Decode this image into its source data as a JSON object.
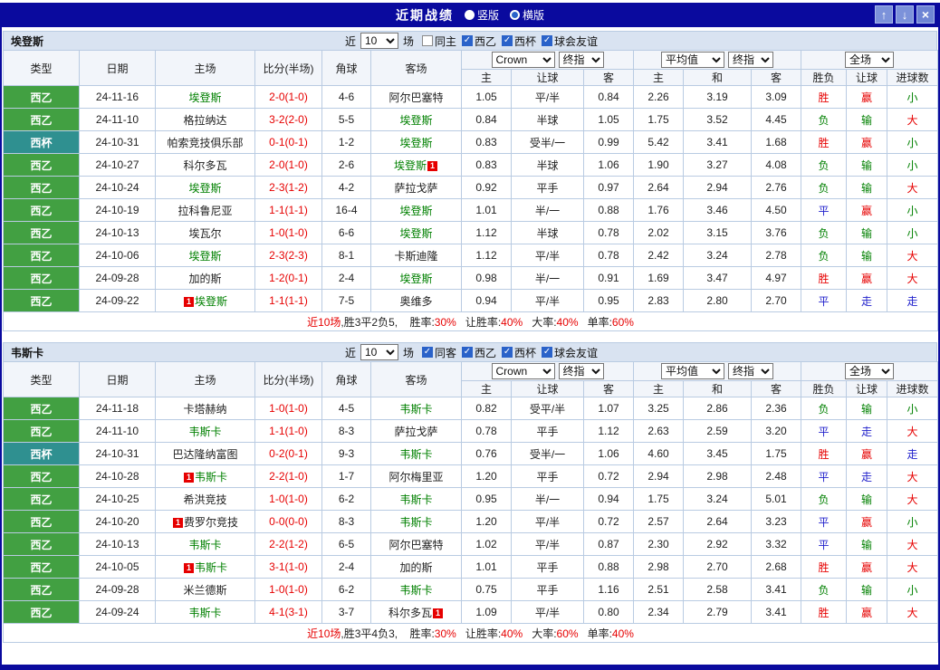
{
  "titlebar": {
    "title": "近期战绩",
    "layout_options": [
      {
        "label": "竖版",
        "selected": false
      },
      {
        "label": "横版",
        "selected": true
      }
    ],
    "up_icon": "↑",
    "down_icon": "↓",
    "close_icon": "×"
  },
  "theme": {
    "league_colors": {
      "西乙": "#42a042",
      "西杯": "#2f9090"
    },
    "result_colors": {
      "胜": "#e60000",
      "平": "#2222cc",
      "负": "#008000",
      "赢": "#e60000",
      "走": "#2222cc",
      "输": "#008000",
      "大": "#e60000",
      "小": "#008000"
    },
    "focus_team_color": "#008000",
    "score_color": "#e60000",
    "summary_red": "#e60000"
  },
  "filter": {
    "near_label": "近",
    "games_label": "场",
    "league_filters": [
      {
        "label": "西乙",
        "checked": true
      },
      {
        "label": "西杯",
        "checked": true
      },
      {
        "label": "球会友谊",
        "checked": true
      }
    ]
  },
  "columns": {
    "type": "类型",
    "date": "日期",
    "home": "主场",
    "score": "比分(半场)",
    "corner": "角球",
    "away": "客场",
    "asian_dropdowns": [
      "Crown",
      "终指"
    ],
    "asian_home": "主",
    "asian_handicap": "让球",
    "asian_away": "客",
    "euro_dropdowns": [
      "平均值",
      "终指"
    ],
    "euro_home": "主",
    "euro_draw": "和",
    "euro_away": "客",
    "result": "胜负",
    "handicap_result": "让球",
    "goals": "进球数",
    "scope_dropdown": "全场"
  },
  "sections": [
    {
      "team": "埃登斯",
      "near_value": "10",
      "same_label": "同主",
      "same_checked": false,
      "rows": [
        {
          "league": "西乙",
          "date": "24-11-16",
          "home": "埃登斯",
          "home_focus": true,
          "away": "阿尔巴塞特",
          "away_focus": false,
          "score": "2-0(1-0)",
          "corner": "4-6",
          "asian_home": "1.05",
          "handicap": "平/半",
          "asian_away": "0.84",
          "euro_home": "2.26",
          "euro_draw": "3.19",
          "euro_away": "3.09",
          "result": "胜",
          "handicap_result": "赢",
          "goals": "小"
        },
        {
          "league": "西乙",
          "date": "24-11-10",
          "home": "格拉纳达",
          "home_focus": false,
          "away": "埃登斯",
          "away_focus": true,
          "score": "3-2(2-0)",
          "corner": "5-5",
          "asian_home": "0.84",
          "handicap": "半球",
          "asian_away": "1.05",
          "euro_home": "1.75",
          "euro_draw": "3.52",
          "euro_away": "4.45",
          "result": "负",
          "handicap_result": "输",
          "goals": "大"
        },
        {
          "league": "西杯",
          "date": "24-10-31",
          "home": "帕索竞技俱乐部",
          "home_focus": false,
          "away": "埃登斯",
          "away_focus": true,
          "score": "0-1(0-1)",
          "corner": "1-2",
          "asian_home": "0.83",
          "handicap": "受半/一",
          "asian_away": "0.99",
          "euro_home": "5.42",
          "euro_draw": "3.41",
          "euro_away": "1.68",
          "result": "胜",
          "handicap_result": "赢",
          "goals": "小"
        },
        {
          "league": "西乙",
          "date": "24-10-27",
          "home": "科尔多瓦",
          "home_focus": false,
          "away": "埃登斯",
          "away_focus": true,
          "away_card_after": "1",
          "score": "2-0(1-0)",
          "corner": "2-6",
          "asian_home": "0.83",
          "handicap": "半球",
          "asian_away": "1.06",
          "euro_home": "1.90",
          "euro_draw": "3.27",
          "euro_away": "4.08",
          "result": "负",
          "handicap_result": "输",
          "goals": "小"
        },
        {
          "league": "西乙",
          "date": "24-10-24",
          "home": "埃登斯",
          "home_focus": true,
          "away": "萨拉戈萨",
          "away_focus": false,
          "score": "2-3(1-2)",
          "corner": "4-2",
          "asian_home": "0.92",
          "handicap": "平手",
          "asian_away": "0.97",
          "euro_home": "2.64",
          "euro_draw": "2.94",
          "euro_away": "2.76",
          "result": "负",
          "handicap_result": "输",
          "goals": "大"
        },
        {
          "league": "西乙",
          "date": "24-10-19",
          "home": "拉科鲁尼亚",
          "home_focus": false,
          "away": "埃登斯",
          "away_focus": true,
          "score": "1-1(1-1)",
          "corner": "16-4",
          "asian_home": "1.01",
          "handicap": "半/一",
          "asian_away": "0.88",
          "euro_home": "1.76",
          "euro_draw": "3.46",
          "euro_away": "4.50",
          "result": "平",
          "handicap_result": "赢",
          "goals": "小"
        },
        {
          "league": "西乙",
          "date": "24-10-13",
          "home": "埃瓦尔",
          "home_focus": false,
          "away": "埃登斯",
          "away_focus": true,
          "score": "1-0(1-0)",
          "corner": "6-6",
          "asian_home": "1.12",
          "handicap": "半球",
          "asian_away": "0.78",
          "euro_home": "2.02",
          "euro_draw": "3.15",
          "euro_away": "3.76",
          "result": "负",
          "handicap_result": "输",
          "goals": "小"
        },
        {
          "league": "西乙",
          "date": "24-10-06",
          "home": "埃登斯",
          "home_focus": true,
          "away": "卡斯迪隆",
          "away_focus": false,
          "score": "2-3(2-3)",
          "corner": "8-1",
          "asian_home": "1.12",
          "handicap": "平/半",
          "asian_away": "0.78",
          "euro_home": "2.42",
          "euro_draw": "3.24",
          "euro_away": "2.78",
          "result": "负",
          "handicap_result": "输",
          "goals": "大"
        },
        {
          "league": "西乙",
          "date": "24-09-28",
          "home": "加的斯",
          "home_focus": false,
          "away": "埃登斯",
          "away_focus": true,
          "score": "1-2(0-1)",
          "corner": "2-4",
          "asian_home": "0.98",
          "handicap": "半/一",
          "asian_away": "0.91",
          "euro_home": "1.69",
          "euro_draw": "3.47",
          "euro_away": "4.97",
          "result": "胜",
          "handicap_result": "赢",
          "goals": "大"
        },
        {
          "league": "西乙",
          "date": "24-09-22",
          "home": "埃登斯",
          "home_focus": true,
          "home_card_before": "1",
          "away": "奥维多",
          "away_focus": false,
          "score": "1-1(1-1)",
          "corner": "7-5",
          "asian_home": "0.94",
          "handicap": "平/半",
          "asian_away": "0.95",
          "euro_home": "2.83",
          "euro_draw": "2.80",
          "euro_away": "2.70",
          "result": "平",
          "handicap_result": "走",
          "goals": "走"
        }
      ],
      "summary": {
        "games": "近10场",
        "record": ",胜3平2负5,",
        "stats": [
          {
            "label": "胜率:",
            "value": "30%"
          },
          {
            "label": "让胜率:",
            "value": "40%"
          },
          {
            "label": "大率:",
            "value": "40%"
          },
          {
            "label": "单率:",
            "value": "60%"
          }
        ]
      }
    },
    {
      "team": "韦斯卡",
      "near_value": "10",
      "same_label": "同客",
      "same_checked": true,
      "rows": [
        {
          "league": "西乙",
          "date": "24-11-18",
          "home": "卡塔赫纳",
          "home_focus": false,
          "away": "韦斯卡",
          "away_focus": true,
          "score": "1-0(1-0)",
          "corner": "4-5",
          "asian_home": "0.82",
          "handicap": "受平/半",
          "asian_away": "1.07",
          "euro_home": "3.25",
          "euro_draw": "2.86",
          "euro_away": "2.36",
          "result": "负",
          "handicap_result": "输",
          "goals": "小"
        },
        {
          "league": "西乙",
          "date": "24-11-10",
          "home": "韦斯卡",
          "home_focus": true,
          "away": "萨拉戈萨",
          "away_focus": false,
          "score": "1-1(1-0)",
          "corner": "8-3",
          "asian_home": "0.78",
          "handicap": "平手",
          "asian_away": "1.12",
          "euro_home": "2.63",
          "euro_draw": "2.59",
          "euro_away": "3.20",
          "result": "平",
          "handicap_result": "走",
          "goals": "大"
        },
        {
          "league": "西杯",
          "date": "24-10-31",
          "home": "巴达隆纳富图",
          "home_focus": false,
          "away": "韦斯卡",
          "away_focus": true,
          "score": "0-2(0-1)",
          "corner": "9-3",
          "asian_home": "0.76",
          "handicap": "受半/一",
          "asian_away": "1.06",
          "euro_home": "4.60",
          "euro_draw": "3.45",
          "euro_away": "1.75",
          "result": "胜",
          "handicap_result": "赢",
          "goals": "走"
        },
        {
          "league": "西乙",
          "date": "24-10-28",
          "home": "韦斯卡",
          "home_focus": true,
          "home_card_before": "1",
          "away": "阿尔梅里亚",
          "away_focus": false,
          "score": "2-2(1-0)",
          "corner": "1-7",
          "asian_home": "1.20",
          "handicap": "平手",
          "asian_away": "0.72",
          "euro_home": "2.94",
          "euro_draw": "2.98",
          "euro_away": "2.48",
          "result": "平",
          "handicap_result": "走",
          "goals": "大"
        },
        {
          "league": "西乙",
          "date": "24-10-25",
          "home": "希洪竞技",
          "home_focus": false,
          "away": "韦斯卡",
          "away_focus": true,
          "score": "1-0(1-0)",
          "corner": "6-2",
          "asian_home": "0.95",
          "handicap": "半/一",
          "asian_away": "0.94",
          "euro_home": "1.75",
          "euro_draw": "3.24",
          "euro_away": "5.01",
          "result": "负",
          "handicap_result": "输",
          "goals": "大"
        },
        {
          "league": "西乙",
          "date": "24-10-20",
          "home": "费罗尔竞技",
          "home_focus": false,
          "home_card_before": "1",
          "away": "韦斯卡",
          "away_focus": true,
          "score": "0-0(0-0)",
          "corner": "8-3",
          "asian_home": "1.20",
          "handicap": "平/半",
          "asian_away": "0.72",
          "euro_home": "2.57",
          "euro_draw": "2.64",
          "euro_away": "3.23",
          "result": "平",
          "handicap_result": "赢",
          "goals": "小"
        },
        {
          "league": "西乙",
          "date": "24-10-13",
          "home": "韦斯卡",
          "home_focus": true,
          "away": "阿尔巴塞特",
          "away_focus": false,
          "score": "2-2(1-2)",
          "corner": "6-5",
          "asian_home": "1.02",
          "handicap": "平/半",
          "asian_away": "0.87",
          "euro_home": "2.30",
          "euro_draw": "2.92",
          "euro_away": "3.32",
          "result": "平",
          "handicap_result": "输",
          "goals": "大"
        },
        {
          "league": "西乙",
          "date": "24-10-05",
          "home": "韦斯卡",
          "home_focus": true,
          "home_card_before": "1",
          "away": "加的斯",
          "away_focus": false,
          "score": "3-1(1-0)",
          "corner": "2-4",
          "asian_home": "1.01",
          "handicap": "平手",
          "asian_away": "0.88",
          "euro_home": "2.98",
          "euro_draw": "2.70",
          "euro_away": "2.68",
          "result": "胜",
          "handicap_result": "赢",
          "goals": "大"
        },
        {
          "league": "西乙",
          "date": "24-09-28",
          "home": "米兰德斯",
          "home_focus": false,
          "away": "韦斯卡",
          "away_focus": true,
          "score": "1-0(1-0)",
          "corner": "6-2",
          "asian_home": "0.75",
          "handicap": "平手",
          "asian_away": "1.16",
          "euro_home": "2.51",
          "euro_draw": "2.58",
          "euro_away": "3.41",
          "result": "负",
          "handicap_result": "输",
          "goals": "小"
        },
        {
          "league": "西乙",
          "date": "24-09-24",
          "home": "韦斯卡",
          "home_focus": true,
          "away": "科尔多瓦",
          "away_focus": false,
          "away_card_after": "1",
          "score": "4-1(3-1)",
          "corner": "3-7",
          "asian_home": "1.09",
          "handicap": "平/半",
          "asian_away": "0.80",
          "euro_home": "2.34",
          "euro_draw": "2.79",
          "euro_away": "3.41",
          "result": "胜",
          "handicap_result": "赢",
          "goals": "大"
        }
      ],
      "summary": {
        "games": "近10场",
        "record": ",胜3平4负3,",
        "stats": [
          {
            "label": "胜率:",
            "value": "30%"
          },
          {
            "label": "让胜率:",
            "value": "40%"
          },
          {
            "label": "大率:",
            "value": "60%"
          },
          {
            "label": "单率:",
            "value": "40%"
          }
        ]
      }
    }
  ]
}
